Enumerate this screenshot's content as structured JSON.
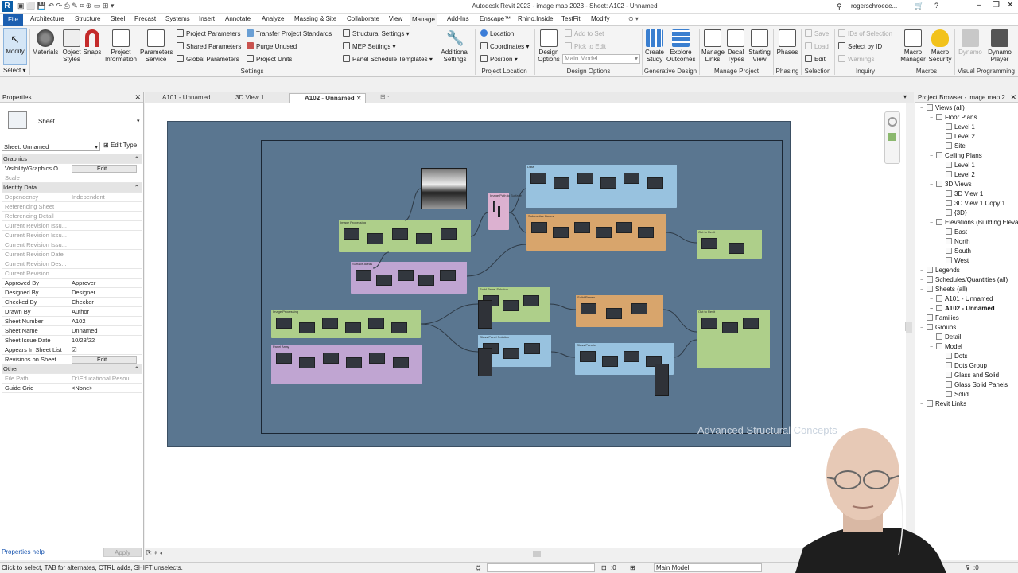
{
  "titlebar": {
    "title": "Autodesk Revit 2023 - image map 2023 - Sheet: A102 - Unnamed",
    "user": "rogerschroede...",
    "logo": "R"
  },
  "menu_tabs": [
    "File",
    "Architecture",
    "Structure",
    "Steel",
    "Precast",
    "Systems",
    "Insert",
    "Annotate",
    "Analyze",
    "Massing & Site",
    "Collaborate",
    "View",
    "Manage",
    "Add-Ins",
    "Enscape™",
    "Rhino.Inside",
    "TestFit",
    "Modify"
  ],
  "active_tab": "Manage",
  "ribbon": {
    "select_label": "Select",
    "big_buttons": [
      {
        "label": "Modify"
      },
      {
        "label": "Materials"
      },
      {
        "label": "Object\nStyles"
      },
      {
        "label": "Snaps"
      },
      {
        "label": "Project\nInformation"
      },
      {
        "label": "Parameters\nService"
      }
    ],
    "settings_small": [
      "Project  Parameters",
      "Shared  Parameters",
      "Global  Parameters",
      "Transfer  Project Standards",
      "Purge  Unused",
      "Project  Units",
      "Structural  Settings",
      "MEP  Settings",
      "Panel Schedule  Templates"
    ],
    "additional_settings": "Additional\nSettings",
    "location_small": [
      "Location",
      "Coordinates",
      "Position"
    ],
    "design_options": {
      "big": "Design\nOptions",
      "add_to_set": "Add to Set",
      "pick_to_edit": "Pick to Edit",
      "main_model": "Main Model"
    },
    "generative": [
      "Create\nStudy",
      "Explore\nOutcomes"
    ],
    "manage_project": [
      "Manage\nLinks",
      "Decal\nTypes",
      "Starting\nView"
    ],
    "phasing": "Phases",
    "selection": [
      "Save",
      "Load",
      "Edit"
    ],
    "inquiry": [
      "IDs of Selection",
      "Select by ID",
      "Warnings"
    ],
    "macros": [
      "Macro\nManager",
      "Macro\nSecurity"
    ],
    "visual_programming": [
      "Dynamo",
      "Dynamo\nPlayer"
    ],
    "panel_labels": [
      "Settings",
      "Project Location",
      "Design Options",
      "Generative Design",
      "Manage Project",
      "Phasing",
      "Selection",
      "Inquiry",
      "Macros",
      "Visual Programming"
    ]
  },
  "properties": {
    "title": "Properties",
    "type_name": "Sheet",
    "selector": "Sheet: Unnamed",
    "edit_type": "Edit Type",
    "rows": [
      {
        "k": "Graphics",
        "cat": true
      },
      {
        "k": "Visibility/Graphics O...",
        "v": "Edit...",
        "btn": true
      },
      {
        "k": "Scale",
        "v": "",
        "grey": true
      },
      {
        "k": "Identity Data",
        "cat": true
      },
      {
        "k": "Dependency",
        "v": "Independent",
        "grey": true
      },
      {
        "k": "Referencing Sheet",
        "v": "",
        "grey": true
      },
      {
        "k": "Referencing Detail",
        "v": "",
        "grey": true
      },
      {
        "k": "Current Revision Issu...",
        "v": "",
        "grey": true
      },
      {
        "k": "Current Revision Issu...",
        "v": "",
        "grey": true
      },
      {
        "k": "Current Revision Issu...",
        "v": "",
        "grey": true
      },
      {
        "k": "Current Revision Date",
        "v": "",
        "grey": true
      },
      {
        "k": "Current Revision Des...",
        "v": "",
        "grey": true
      },
      {
        "k": "Current Revision",
        "v": "",
        "grey": true
      },
      {
        "k": "Approved By",
        "v": "Approver"
      },
      {
        "k": "Designed By",
        "v": "Designer"
      },
      {
        "k": "Checked By",
        "v": "Checker"
      },
      {
        "k": "Drawn By",
        "v": "Author"
      },
      {
        "k": "Sheet Number",
        "v": "A102"
      },
      {
        "k": "Sheet Name",
        "v": "Unnamed"
      },
      {
        "k": "Sheet Issue Date",
        "v": "10/28/22"
      },
      {
        "k": "Appears In Sheet List",
        "v": "☑"
      },
      {
        "k": "Revisions on Sheet",
        "v": "Edit...",
        "btn": true
      },
      {
        "k": "Other",
        "cat": true
      },
      {
        "k": "File Path",
        "v": "D:\\Educational Resou...",
        "grey": true
      },
      {
        "k": "Guide Grid",
        "v": "<None>"
      }
    ],
    "help": "Properties help",
    "apply": "Apply"
  },
  "view_tabs": [
    {
      "label": "A101 - Unnamed",
      "active": false
    },
    {
      "label": "3D View 1",
      "active": false
    },
    {
      "label": "A102 - Unnamed",
      "active": true
    }
  ],
  "sheet": {
    "watermark": "Advanced Structural Concepts",
    "group_titles": [
      "Image Processing",
      "Surface Areas",
      "Image Processing",
      "Panel Array",
      "Data",
      "Subtractive Boxes",
      "Out to Revit",
      "Solid Panel Solution",
      "Solid Panels",
      "Glass Panel Solution",
      "Glass Panels",
      "Out to Revit",
      "Image Path to Surface"
    ]
  },
  "browser": {
    "title": "Project Browser - image map 2...",
    "items": [
      {
        "t": "Views (all)",
        "lvl": 0
      },
      {
        "t": "Floor Plans",
        "lvl": 1
      },
      {
        "t": "Level 1",
        "lvl": 2
      },
      {
        "t": "Level 2",
        "lvl": 2
      },
      {
        "t": "Site",
        "lvl": 2
      },
      {
        "t": "Ceiling Plans",
        "lvl": 1
      },
      {
        "t": "Level 1",
        "lvl": 2
      },
      {
        "t": "Level 2",
        "lvl": 2
      },
      {
        "t": "3D Views",
        "lvl": 1
      },
      {
        "t": "3D View 1",
        "lvl": 2,
        "hl": true
      },
      {
        "t": "3D View 1 Copy 1",
        "lvl": 2,
        "hl": true
      },
      {
        "t": "{3D}",
        "lvl": 2,
        "hl": true
      },
      {
        "t": "Elevations (Building Elevatio",
        "lvl": 1
      },
      {
        "t": "East",
        "lvl": 2
      },
      {
        "t": "North",
        "lvl": 2
      },
      {
        "t": "South",
        "lvl": 2
      },
      {
        "t": "West",
        "lvl": 2
      },
      {
        "t": "Legends",
        "lvl": 0
      },
      {
        "t": "Schedules/Quantities (all)",
        "lvl": 0
      },
      {
        "t": "Sheets (all)",
        "lvl": 0
      },
      {
        "t": "A101 - Unnamed",
        "lvl": 1
      },
      {
        "t": "A102 - Unnamed",
        "lvl": 1,
        "sel": true
      },
      {
        "t": "Families",
        "lvl": 0
      },
      {
        "t": "Groups",
        "lvl": 0
      },
      {
        "t": "Detail",
        "lvl": 1
      },
      {
        "t": "Model",
        "lvl": 1
      },
      {
        "t": "Dots",
        "lvl": 2
      },
      {
        "t": "Dots Group",
        "lvl": 2
      },
      {
        "t": "Glass and Solid",
        "lvl": 2
      },
      {
        "t": "Glass Solid Panels",
        "lvl": 2
      },
      {
        "t": "Solid",
        "lvl": 2
      },
      {
        "t": "Revit Links",
        "lvl": 0
      }
    ]
  },
  "status": {
    "message": "Click to select, TAB for alternates, CTRL adds, SHIFT unselects.",
    "zero_a": ":0",
    "model": "Main Model",
    "zero_b": ":0"
  },
  "colors": {
    "accent": "#1c5fb0",
    "sheet_bg": "#5a7690",
    "green": "#b6d78a",
    "purple": "#c9a9d8",
    "blue": "#9ec9e6",
    "orange": "#e3a96a",
    "pink": "#e8b7d6"
  }
}
